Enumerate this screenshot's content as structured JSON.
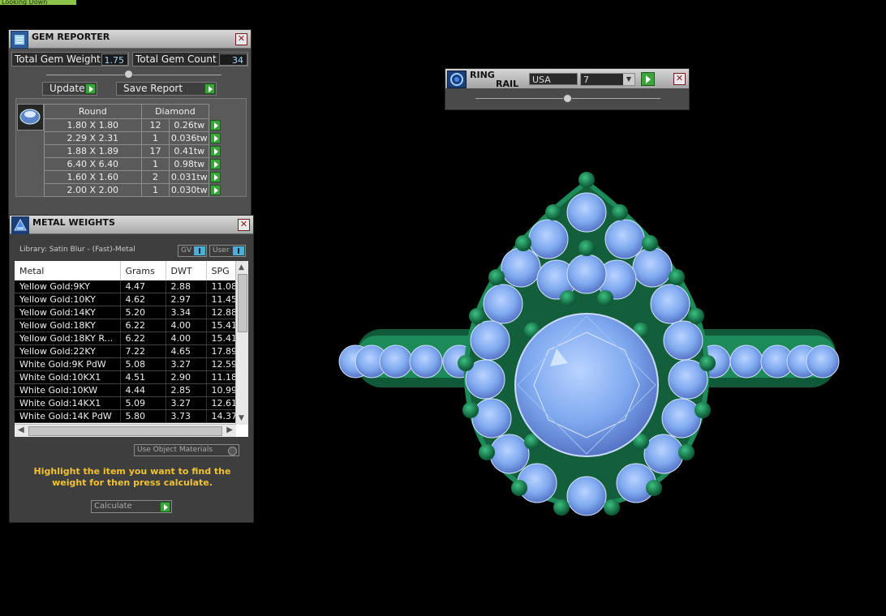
{
  "top_fragment": "Looking Down",
  "gem_reporter": {
    "title": "GEM REPORTER",
    "total_weight_label": "Total Gem Weight",
    "total_weight_value": "1.75",
    "total_count_label": "Total Gem Count",
    "total_count_value": "34",
    "update_label": "Update",
    "save_report_label": "Save Report",
    "shape_header": "Round",
    "material_header": "Diamond",
    "rows": [
      {
        "size": "1.80 X 1.80",
        "count": "12",
        "weight": "0.26tw"
      },
      {
        "size": "2.29 X 2.31",
        "count": "1",
        "weight": "0.036tw"
      },
      {
        "size": "1.88 X 1.89",
        "count": "17",
        "weight": "0.41tw"
      },
      {
        "size": "6.40 X 6.40",
        "count": "1",
        "weight": "0.98tw"
      },
      {
        "size": "1.60 X 1.60",
        "count": "2",
        "weight": "0.031tw"
      },
      {
        "size": "2.00 X 2.00",
        "count": "1",
        "weight": "0.030tw"
      }
    ]
  },
  "metal_weights": {
    "title": "METAL WEIGHTS",
    "library_label": "Library: Satin Blur - (Fast)-Metal",
    "gv_label": "GV",
    "user_label": "User",
    "columns": [
      "Metal",
      "Grams",
      "DWT",
      "SPG"
    ],
    "rows": [
      [
        "Yellow Gold:9KY",
        "4.47",
        "2.88",
        "11.08"
      ],
      [
        "Yellow Gold:10KY",
        "4.62",
        "2.97",
        "11.45"
      ],
      [
        "Yellow Gold:14KY",
        "5.20",
        "3.34",
        "12.88"
      ],
      [
        "Yellow Gold:18KY",
        "6.22",
        "4.00",
        "15.41"
      ],
      [
        "Yellow Gold:18KY R...",
        "6.22",
        "4.00",
        "15.41"
      ],
      [
        "Yellow Gold:22KY",
        "7.22",
        "4.65",
        "17.89"
      ],
      [
        "White Gold:9K PdW",
        "5.08",
        "3.27",
        "12.59"
      ],
      [
        "White Gold:10KX1",
        "4.51",
        "2.90",
        "11.18"
      ],
      [
        "White Gold:10KW",
        "4.44",
        "2.85",
        "10.99"
      ],
      [
        "White Gold:14KX1",
        "5.09",
        "3.27",
        "12.61"
      ],
      [
        "White Gold:14K PdW",
        "5.80",
        "3.73",
        "14.37"
      ]
    ],
    "use_object_materials": "Use Object Materials",
    "instruction": "Highlight the item you want to find the weight for then press calculate.",
    "calculate_label": "Calculate"
  },
  "ring_rail": {
    "title_line1": "RING",
    "title_line2": "RAIL",
    "country": "USA",
    "size": "7"
  },
  "colors": {
    "metal_green": "#1d8a5a",
    "gem_blue": "#7fa9ef",
    "instruction_yellow": "#f1c232",
    "go_green": "#3aa53a"
  }
}
